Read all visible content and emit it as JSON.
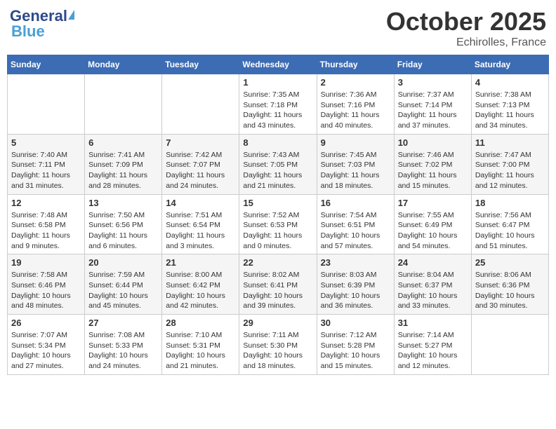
{
  "header": {
    "logo_general": "General",
    "logo_blue": "Blue",
    "month": "October 2025",
    "location": "Echirolles, France"
  },
  "days_of_week": [
    "Sunday",
    "Monday",
    "Tuesday",
    "Wednesday",
    "Thursday",
    "Friday",
    "Saturday"
  ],
  "weeks": [
    [
      {
        "day": "",
        "info": ""
      },
      {
        "day": "",
        "info": ""
      },
      {
        "day": "",
        "info": ""
      },
      {
        "day": "1",
        "info": "Sunrise: 7:35 AM\nSunset: 7:18 PM\nDaylight: 11 hours and 43 minutes."
      },
      {
        "day": "2",
        "info": "Sunrise: 7:36 AM\nSunset: 7:16 PM\nDaylight: 11 hours and 40 minutes."
      },
      {
        "day": "3",
        "info": "Sunrise: 7:37 AM\nSunset: 7:14 PM\nDaylight: 11 hours and 37 minutes."
      },
      {
        "day": "4",
        "info": "Sunrise: 7:38 AM\nSunset: 7:13 PM\nDaylight: 11 hours and 34 minutes."
      }
    ],
    [
      {
        "day": "5",
        "info": "Sunrise: 7:40 AM\nSunset: 7:11 PM\nDaylight: 11 hours and 31 minutes."
      },
      {
        "day": "6",
        "info": "Sunrise: 7:41 AM\nSunset: 7:09 PM\nDaylight: 11 hours and 28 minutes."
      },
      {
        "day": "7",
        "info": "Sunrise: 7:42 AM\nSunset: 7:07 PM\nDaylight: 11 hours and 24 minutes."
      },
      {
        "day": "8",
        "info": "Sunrise: 7:43 AM\nSunset: 7:05 PM\nDaylight: 11 hours and 21 minutes."
      },
      {
        "day": "9",
        "info": "Sunrise: 7:45 AM\nSunset: 7:03 PM\nDaylight: 11 hours and 18 minutes."
      },
      {
        "day": "10",
        "info": "Sunrise: 7:46 AM\nSunset: 7:02 PM\nDaylight: 11 hours and 15 minutes."
      },
      {
        "day": "11",
        "info": "Sunrise: 7:47 AM\nSunset: 7:00 PM\nDaylight: 11 hours and 12 minutes."
      }
    ],
    [
      {
        "day": "12",
        "info": "Sunrise: 7:48 AM\nSunset: 6:58 PM\nDaylight: 11 hours and 9 minutes."
      },
      {
        "day": "13",
        "info": "Sunrise: 7:50 AM\nSunset: 6:56 PM\nDaylight: 11 hours and 6 minutes."
      },
      {
        "day": "14",
        "info": "Sunrise: 7:51 AM\nSunset: 6:54 PM\nDaylight: 11 hours and 3 minutes."
      },
      {
        "day": "15",
        "info": "Sunrise: 7:52 AM\nSunset: 6:53 PM\nDaylight: 11 hours and 0 minutes."
      },
      {
        "day": "16",
        "info": "Sunrise: 7:54 AM\nSunset: 6:51 PM\nDaylight: 10 hours and 57 minutes."
      },
      {
        "day": "17",
        "info": "Sunrise: 7:55 AM\nSunset: 6:49 PM\nDaylight: 10 hours and 54 minutes."
      },
      {
        "day": "18",
        "info": "Sunrise: 7:56 AM\nSunset: 6:47 PM\nDaylight: 10 hours and 51 minutes."
      }
    ],
    [
      {
        "day": "19",
        "info": "Sunrise: 7:58 AM\nSunset: 6:46 PM\nDaylight: 10 hours and 48 minutes."
      },
      {
        "day": "20",
        "info": "Sunrise: 7:59 AM\nSunset: 6:44 PM\nDaylight: 10 hours and 45 minutes."
      },
      {
        "day": "21",
        "info": "Sunrise: 8:00 AM\nSunset: 6:42 PM\nDaylight: 10 hours and 42 minutes."
      },
      {
        "day": "22",
        "info": "Sunrise: 8:02 AM\nSunset: 6:41 PM\nDaylight: 10 hours and 39 minutes."
      },
      {
        "day": "23",
        "info": "Sunrise: 8:03 AM\nSunset: 6:39 PM\nDaylight: 10 hours and 36 minutes."
      },
      {
        "day": "24",
        "info": "Sunrise: 8:04 AM\nSunset: 6:37 PM\nDaylight: 10 hours and 33 minutes."
      },
      {
        "day": "25",
        "info": "Sunrise: 8:06 AM\nSunset: 6:36 PM\nDaylight: 10 hours and 30 minutes."
      }
    ],
    [
      {
        "day": "26",
        "info": "Sunrise: 7:07 AM\nSunset: 5:34 PM\nDaylight: 10 hours and 27 minutes."
      },
      {
        "day": "27",
        "info": "Sunrise: 7:08 AM\nSunset: 5:33 PM\nDaylight: 10 hours and 24 minutes."
      },
      {
        "day": "28",
        "info": "Sunrise: 7:10 AM\nSunset: 5:31 PM\nDaylight: 10 hours and 21 minutes."
      },
      {
        "day": "29",
        "info": "Sunrise: 7:11 AM\nSunset: 5:30 PM\nDaylight: 10 hours and 18 minutes."
      },
      {
        "day": "30",
        "info": "Sunrise: 7:12 AM\nSunset: 5:28 PM\nDaylight: 10 hours and 15 minutes."
      },
      {
        "day": "31",
        "info": "Sunrise: 7:14 AM\nSunset: 5:27 PM\nDaylight: 10 hours and 12 minutes."
      },
      {
        "day": "",
        "info": ""
      }
    ]
  ]
}
